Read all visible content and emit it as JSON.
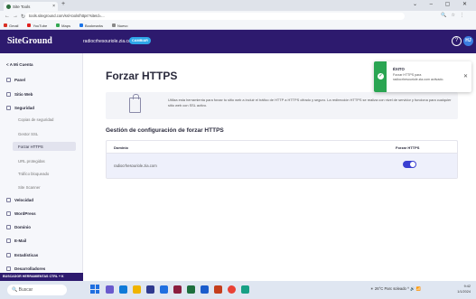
{
  "browser": {
    "tab_title": "Site Tools",
    "url": "tools.siteground.com/ssl-tools/https?siteId=...",
    "bookmarks": [
      "Gmail",
      "YouTube",
      "Maps",
      "Bookmarks",
      "Nuevo"
    ]
  },
  "header": {
    "logo": "SiteGround",
    "site": "radiocrhesouriole.zia.com",
    "change_label": "CAMBIAR",
    "help": "?",
    "avatar": "HJ"
  },
  "sidebar": {
    "back": "< A Mi Cuenta",
    "items": [
      "Panel",
      "Sitio Web",
      "Seguridad"
    ],
    "security_sub": [
      "Copias de seguridad",
      "Gestor SSL",
      "Forzar HTTPS",
      "URL protegidas",
      "Tráfico bloqueado",
      "Site Scanner"
    ],
    "items2": [
      "Velocidad",
      "WordPress",
      "Dominio",
      "E-Mail",
      "Estadísticas",
      "Desarrolladores"
    ],
    "bottom_text": "BUSCADOR HERRAMIENTAS CTRL + K"
  },
  "main": {
    "title": "Forzar HTTPS",
    "info": "Utiliza esta herramienta para forzar tu sitio web a incluir el tráfico de HTTP a HTTPS cifrado y seguro. La redirección HTTPS se realiza con nivel de servidor y funciona para cualquier sitio web con SSL activo.",
    "section_title": "Gestión de configuración de forzar HTTPS",
    "table": {
      "col_domain": "Dominio",
      "col_force": "Forzar HTTPS",
      "rows": [
        {
          "domain": "radiocrhesouriole.zia.com",
          "enabled": true
        }
      ]
    }
  },
  "toast": {
    "title": "ÉXITO",
    "message": "Forzar HTTPS para radiocrhesouriole.zia.com activado."
  },
  "taskbar": {
    "search": "Buscar",
    "weather": "26°C Parc soleado",
    "time": "9:42",
    "date": "1/1/2024"
  },
  "colors": {
    "header_bg": "#2d1a6e",
    "accent": "#3a3fd1",
    "success": "#2aa552"
  }
}
